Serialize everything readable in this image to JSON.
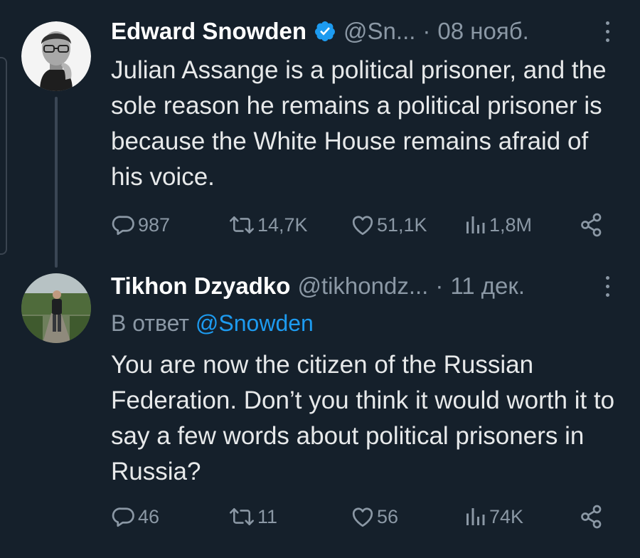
{
  "tweets": [
    {
      "author": {
        "name": "Edward Snowden",
        "handle": "@Sn...",
        "verified": true,
        "avatar": "edward-snowden-photo"
      },
      "separator": "·",
      "date": "08 нояб.",
      "text": "Julian Assange is a political prisoner, and the sole reason he remains a political prisoner is because the White House remains afraid of his voice.",
      "stats": {
        "replies": "987",
        "retweets": "14,7K",
        "likes": "51,1K",
        "views": "1,8M"
      }
    },
    {
      "author": {
        "name": "Tikhon Dzyadko",
        "handle": "@tikhondz...",
        "verified": false,
        "avatar": "tikhon-dzyadko-photo"
      },
      "separator": "·",
      "date": "11 дек.",
      "reply_to": {
        "prefix": "В ответ",
        "mention": "@Snowden"
      },
      "text": "You are now the citizen of the Russian Federation. Don’t you think it would worth it to say a few words about political prisoners in Russia?",
      "stats": {
        "replies": "46",
        "retweets": "11",
        "likes": "56",
        "views": "74K"
      }
    }
  ],
  "icons": {
    "reply": "speech-bubble-icon",
    "retweet": "retweet-arrows-icon",
    "like": "heart-icon",
    "views": "bar-chart-icon",
    "share": "share-nodes-icon",
    "more": "vertical-ellipsis-icon",
    "verified": "verified-badge-icon"
  },
  "colors": {
    "background": "#15202b",
    "text": "#e7e9ea",
    "muted": "#8b98a5",
    "accent": "#1d9bf0"
  }
}
